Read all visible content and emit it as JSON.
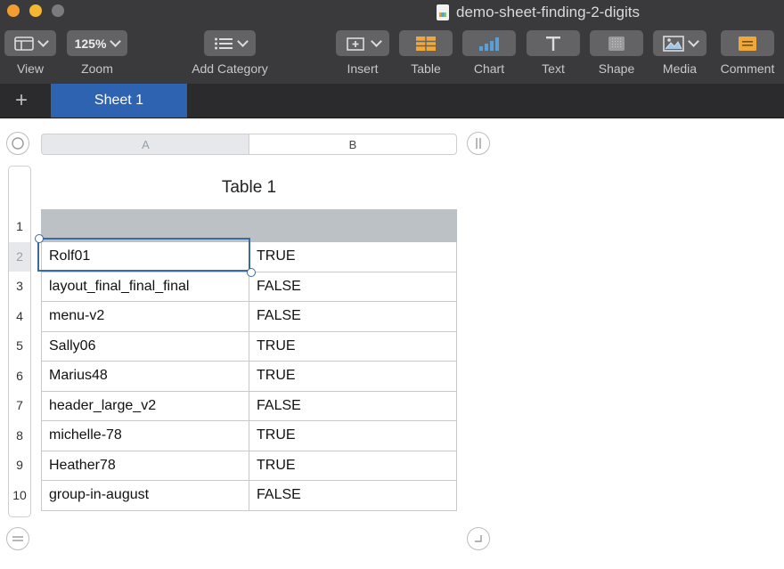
{
  "window": {
    "title": "demo-sheet-finding-2-digits"
  },
  "toolbar": {
    "view_label": "View",
    "zoom_value": "125%",
    "zoom_label": "Zoom",
    "add_category_label": "Add Category",
    "insert_label": "Insert",
    "table_label": "Table",
    "chart_label": "Chart",
    "text_label": "Text",
    "shape_label": "Shape",
    "media_label": "Media",
    "comment_label": "Comment",
    "accent_color": "#f0a83a"
  },
  "tabs": {
    "add_icon": "+",
    "active": "Sheet 1",
    "active_color": "#2d63b1"
  },
  "sheet": {
    "columns": [
      "A",
      "B"
    ],
    "table_title": "Table 1",
    "row_numbers": [
      "1",
      "2",
      "3",
      "4",
      "5",
      "6",
      "7",
      "8",
      "9",
      "10"
    ],
    "rows": [
      [
        "",
        ""
      ],
      [
        "Rolf01",
        "TRUE"
      ],
      [
        "layout_final_final_final",
        "FALSE"
      ],
      [
        "menu-v2",
        "FALSE"
      ],
      [
        "Sally06",
        "TRUE"
      ],
      [
        "Marius48",
        "TRUE"
      ],
      [
        "header_large_v2",
        "FALSE"
      ],
      [
        "michelle-78",
        "TRUE"
      ],
      [
        "Heather78",
        "TRUE"
      ],
      [
        "group-in-august",
        "FALSE"
      ]
    ],
    "selected_cell": "A2"
  }
}
